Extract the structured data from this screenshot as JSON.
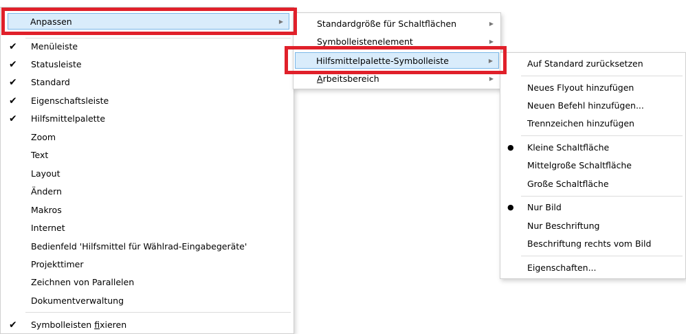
{
  "menu1": {
    "header": "Anpassen",
    "items": [
      {
        "label": "Menüleiste",
        "checked": true
      },
      {
        "label": "Statusleiste",
        "checked": true
      },
      {
        "label": "Standard",
        "checked": true
      },
      {
        "label": "Eigenschaftsleiste",
        "checked": true
      },
      {
        "label": "Hilfsmittelpalette",
        "checked": true
      },
      {
        "label": "Zoom",
        "checked": false
      },
      {
        "label": "Text",
        "checked": false
      },
      {
        "label": "Layout",
        "checked": false
      },
      {
        "label": "Ändern",
        "checked": false
      },
      {
        "label": "Makros",
        "checked": false
      },
      {
        "label": "Internet",
        "checked": false
      },
      {
        "label": "Bedienfeld 'Hilfsmittel für Wählrad-Eingabegeräte'",
        "checked": false
      },
      {
        "label": "Projekttimer",
        "checked": false
      },
      {
        "label": "Zeichnen von Parallelen",
        "checked": false
      },
      {
        "label": "Dokumentverwaltung",
        "checked": false
      }
    ],
    "lock": {
      "label_pre": "Symbolleisten ",
      "label_underlined": "f",
      "label_post": "ixieren",
      "checked": true
    }
  },
  "menu2": {
    "items": [
      {
        "label": "Standardgröße für Schaltflächen"
      },
      {
        "label": "Symbolleistenelement"
      },
      {
        "label": "Hilfsmittelpalette-Symbolleiste"
      },
      {
        "label_underlined": "A",
        "label_rest": "rbeitsbereich"
      }
    ]
  },
  "menu3": {
    "group1": [
      "Auf Standard zurücksetzen"
    ],
    "group2": [
      "Neues Flyout hinzufügen",
      "Neuen Befehl hinzufügen...",
      "Trennzeichen hinzufügen"
    ],
    "group3": [
      "Kleine Schaltfläche",
      "Mittelgroße Schaltfläche",
      "Große Schaltfläche"
    ],
    "group4": [
      "Nur Bild",
      "Nur Beschriftung",
      "Beschriftung rechts vom Bild"
    ],
    "group5": [
      "Eigenschaften..."
    ]
  },
  "glyphs": {
    "check": "✔",
    "bullet": "●",
    "arrow": "▶"
  },
  "colors": {
    "highlight": "#d9ecfb",
    "highlight_border": "#7ab7e8",
    "callout": "#e0202a"
  }
}
